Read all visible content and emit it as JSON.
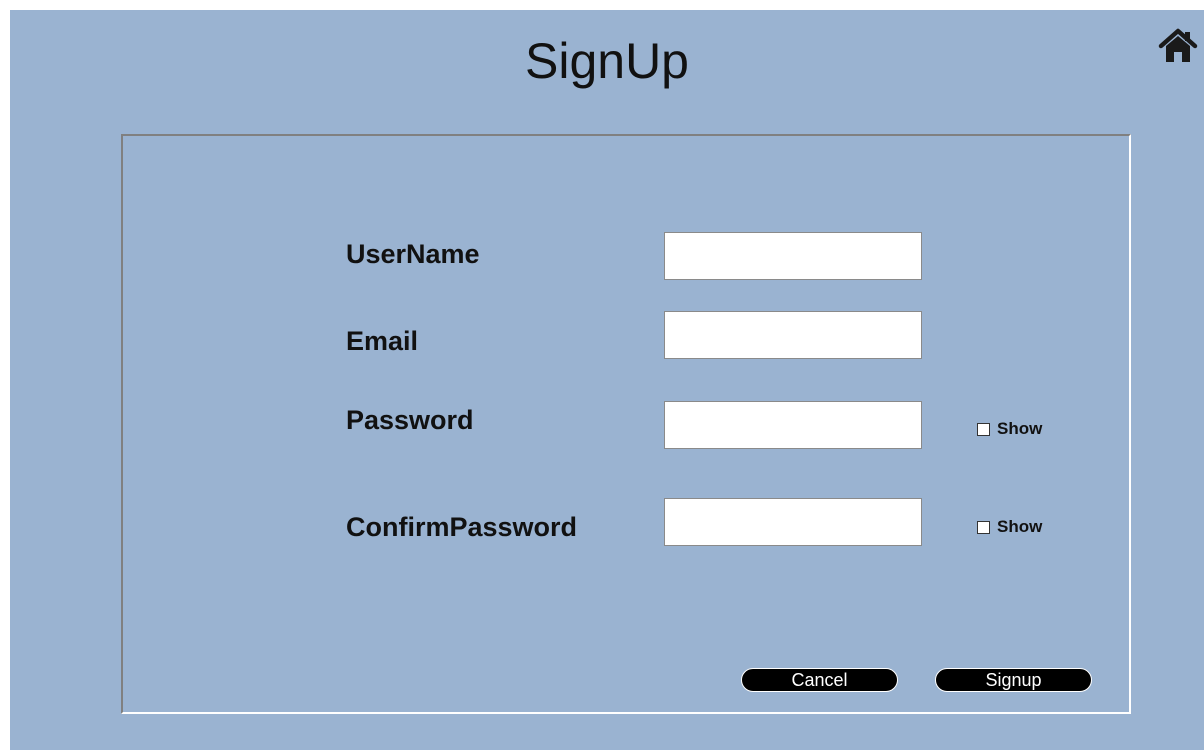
{
  "window": {
    "title": "SignUp",
    "background_color": "#9ab3d1"
  },
  "home": {
    "icon": "home-icon"
  },
  "form": {
    "username_label": "UserName",
    "username_value": "",
    "email_label": "Email",
    "email_value": "",
    "password_label": "Password",
    "password_value": "",
    "password_show_label": "Show",
    "password_show_checked": false,
    "confirm_label": "ConfirmPassword",
    "confirm_value": "",
    "confirm_show_label": "Show",
    "confirm_show_checked": false
  },
  "buttons": {
    "cancel_label": "Cancel",
    "signup_label": "Signup",
    "button_color": "#000000"
  }
}
